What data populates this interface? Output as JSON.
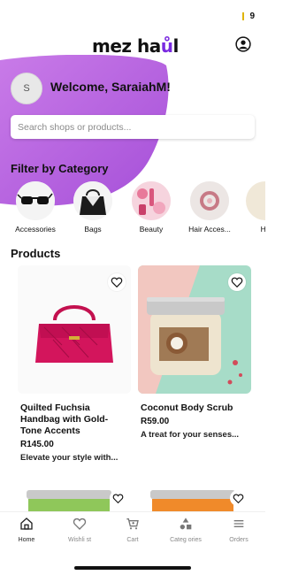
{
  "status": {
    "signal_text": "9"
  },
  "header": {
    "logo_text": "mez ha",
    "logo_accent": "ů",
    "logo_end": "l"
  },
  "hero": {
    "avatar_initial": "S",
    "welcome_text": "Welcome, SaraiahM!",
    "search_placeholder": "Search shops or products..."
  },
  "filter": {
    "title": "Filter by Category",
    "categories": [
      {
        "label": "Accessories"
      },
      {
        "label": "Bags"
      },
      {
        "label": "Beauty"
      },
      {
        "label": "Hair Acces..."
      },
      {
        "label": "He"
      }
    ]
  },
  "products": {
    "title": "Products",
    "items": [
      {
        "name": "Quilted Fuchsia Handbag with Gold-Tone Accents",
        "price": "R145.00",
        "desc": "Elevate your style with..."
      },
      {
        "name": "Coconut Body Scrub",
        "price": "R59.00",
        "desc": "A treat for your senses..."
      }
    ]
  },
  "nav": {
    "items": [
      {
        "label": "Home"
      },
      {
        "label": "Wishli st"
      },
      {
        "label": "Cart"
      },
      {
        "label": "Categ ories"
      },
      {
        "label": "Orders"
      }
    ]
  },
  "colors": {
    "hero_gradient_start": "#c76ae8",
    "hero_gradient_end": "#a24ed6",
    "logo_accent": "#7a2ae0"
  }
}
